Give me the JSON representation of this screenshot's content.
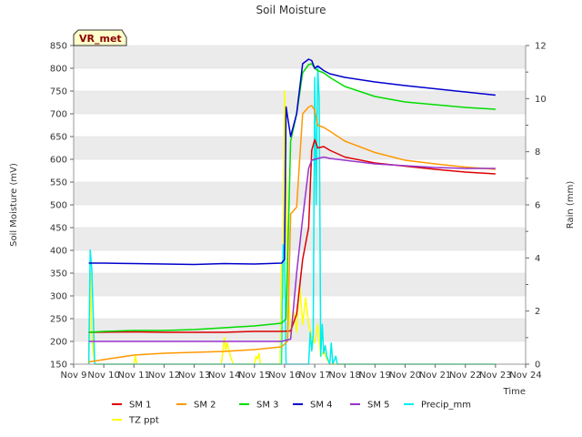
{
  "chart_data": {
    "type": "line",
    "title": "Soil Moisture",
    "tag_label": "VR_met",
    "xlabel": "Time",
    "ylabel": "Soil Moisture (mV)",
    "y2label": "Rain (mm)",
    "x_tick_labels": [
      "Nov 9",
      "Nov 10",
      "Nov 11",
      "Nov 12",
      "Nov 13",
      "Nov 14",
      "Nov 15",
      "Nov 16",
      "Nov 17",
      "Nov 18",
      "Nov 19",
      "Nov 20",
      "Nov 21",
      "Nov 22",
      "Nov 23",
      "Nov 24"
    ],
    "xlim": [
      9,
      24
    ],
    "ylim": [
      150,
      850
    ],
    "y2lim": [
      0,
      12
    ],
    "y_ticks": [
      150,
      200,
      250,
      300,
      350,
      400,
      450,
      500,
      550,
      600,
      650,
      700,
      750,
      800,
      850
    ],
    "y2_ticks": [
      0,
      2,
      4,
      6,
      8,
      10,
      12
    ],
    "grid": "horizontal bands",
    "legend_placement": "bottom",
    "series": [
      {
        "name": "SM 1",
        "axis": "left",
        "color": "#dd0000",
        "x": [
          9.5,
          11,
          12,
          13,
          14,
          15,
          15.9,
          16.2,
          16.4,
          16.6,
          16.8,
          16.9,
          17.0,
          17.1,
          17.3,
          17.5,
          18,
          19,
          20,
          21,
          22,
          23
        ],
        "y": [
          220,
          221,
          220,
          220,
          220,
          222,
          222,
          223,
          260,
          380,
          450,
          620,
          643,
          625,
          628,
          620,
          605,
          592,
          585,
          578,
          572,
          568
        ]
      },
      {
        "name": "SM 2",
        "axis": "left",
        "color": "#ff9900",
        "x": [
          9.5,
          10,
          11,
          12,
          13,
          14,
          15,
          15.9,
          16.1,
          16.2,
          16.4,
          16.6,
          16.8,
          16.9,
          17.0,
          17.1,
          17.3,
          17.5,
          18,
          19,
          20,
          21,
          22,
          23
        ],
        "y": [
          155,
          160,
          170,
          174,
          176,
          178,
          182,
          188,
          200,
          480,
          495,
          700,
          715,
          718,
          708,
          675,
          670,
          662,
          640,
          615,
          598,
          590,
          583,
          578
        ]
      },
      {
        "name": "SM 3",
        "axis": "left",
        "color": "#00dd00",
        "x": [
          9.5,
          10,
          11,
          12,
          13,
          14,
          15,
          15.9,
          16.05,
          16.2,
          16.4,
          16.6,
          16.8,
          16.9,
          17.0,
          17.1,
          17.3,
          17.5,
          18,
          19,
          20,
          21,
          22,
          23
        ],
        "y": [
          220,
          222,
          224,
          224,
          226,
          230,
          234,
          240,
          250,
          640,
          700,
          790,
          808,
          810,
          800,
          795,
          790,
          780,
          760,
          738,
          726,
          720,
          714,
          710
        ]
      },
      {
        "name": "SM 4",
        "axis": "left",
        "color": "#0000cc",
        "x": [
          9.5,
          10,
          11,
          12,
          13,
          14,
          15,
          15.9,
          16.0,
          16.05,
          16.2,
          16.4,
          16.6,
          16.8,
          16.9,
          17.0,
          17.1,
          17.3,
          17.5,
          18,
          19,
          20,
          21,
          22,
          23
        ],
        "y": [
          372,
          372,
          371,
          370,
          369,
          371,
          370,
          372,
          380,
          715,
          650,
          700,
          810,
          820,
          817,
          800,
          805,
          795,
          788,
          780,
          770,
          762,
          755,
          748,
          741
        ]
      },
      {
        "name": "SM 5",
        "axis": "left",
        "color": "#9933cc",
        "x": [
          9.5,
          10,
          11,
          12,
          13,
          14,
          15,
          15.9,
          16.2,
          16.4,
          16.6,
          16.8,
          16.9,
          17.0,
          17.3,
          17.5,
          18,
          19,
          20,
          21,
          22,
          23
        ],
        "y": [
          200,
          200,
          200,
          200,
          200,
          200,
          200,
          200,
          205,
          350,
          470,
          580,
          598,
          600,
          605,
          602,
          598,
          590,
          586,
          582,
          580,
          580
        ]
      },
      {
        "name": "Precip_mm",
        "axis": "right",
        "color": "#00eeee",
        "x": [
          9.5,
          9.55,
          9.6,
          9.7,
          15.9,
          15.95,
          16.0,
          16.05,
          16.8,
          16.85,
          16.9,
          16.95,
          17.0,
          17.05,
          17.1,
          17.15,
          17.2,
          17.25,
          17.3,
          17.35,
          17.4,
          17.5,
          17.55,
          17.6,
          17.7,
          17.75,
          17.8,
          23
        ],
        "y": [
          0,
          4.3,
          3.6,
          0,
          0,
          4.5,
          4.1,
          0,
          0,
          1.2,
          0.5,
          1.1,
          10.8,
          6.0,
          11.2,
          10.0,
          0.3,
          1.5,
          0.4,
          0.7,
          0.3,
          0,
          0.8,
          0,
          0.3,
          0,
          0,
          0
        ]
      },
      {
        "name": "TZ ppt",
        "axis": "right",
        "color": "#ffff00",
        "x": [
          9.5,
          9.55,
          9.6,
          9.65,
          9.7,
          11.0,
          11.05,
          11.1,
          13.9,
          14.0,
          14.05,
          14.1,
          14.2,
          14.3,
          15.0,
          15.05,
          15.1,
          15.15,
          15.2,
          15.85,
          15.9,
          15.95,
          16.0,
          16.1,
          16.2,
          16.3,
          16.4,
          16.5,
          16.6,
          16.7,
          16.8,
          16.9,
          17.0,
          17.1,
          17.2,
          17.3,
          17.4,
          17.5,
          23
        ],
        "y": [
          0,
          3.5,
          1.2,
          0.5,
          0,
          0,
          0.3,
          0,
          0,
          1.0,
          0.5,
          0.8,
          0.3,
          0,
          0,
          0.3,
          0.2,
          0.4,
          0,
          0,
          3.8,
          2.5,
          10.3,
          3.5,
          1.0,
          2.0,
          1.2,
          3.0,
          1.5,
          2.5,
          1.5,
          1.0,
          0.8,
          1.5,
          0.3,
          0.5,
          0.2,
          0,
          0
        ]
      }
    ]
  }
}
